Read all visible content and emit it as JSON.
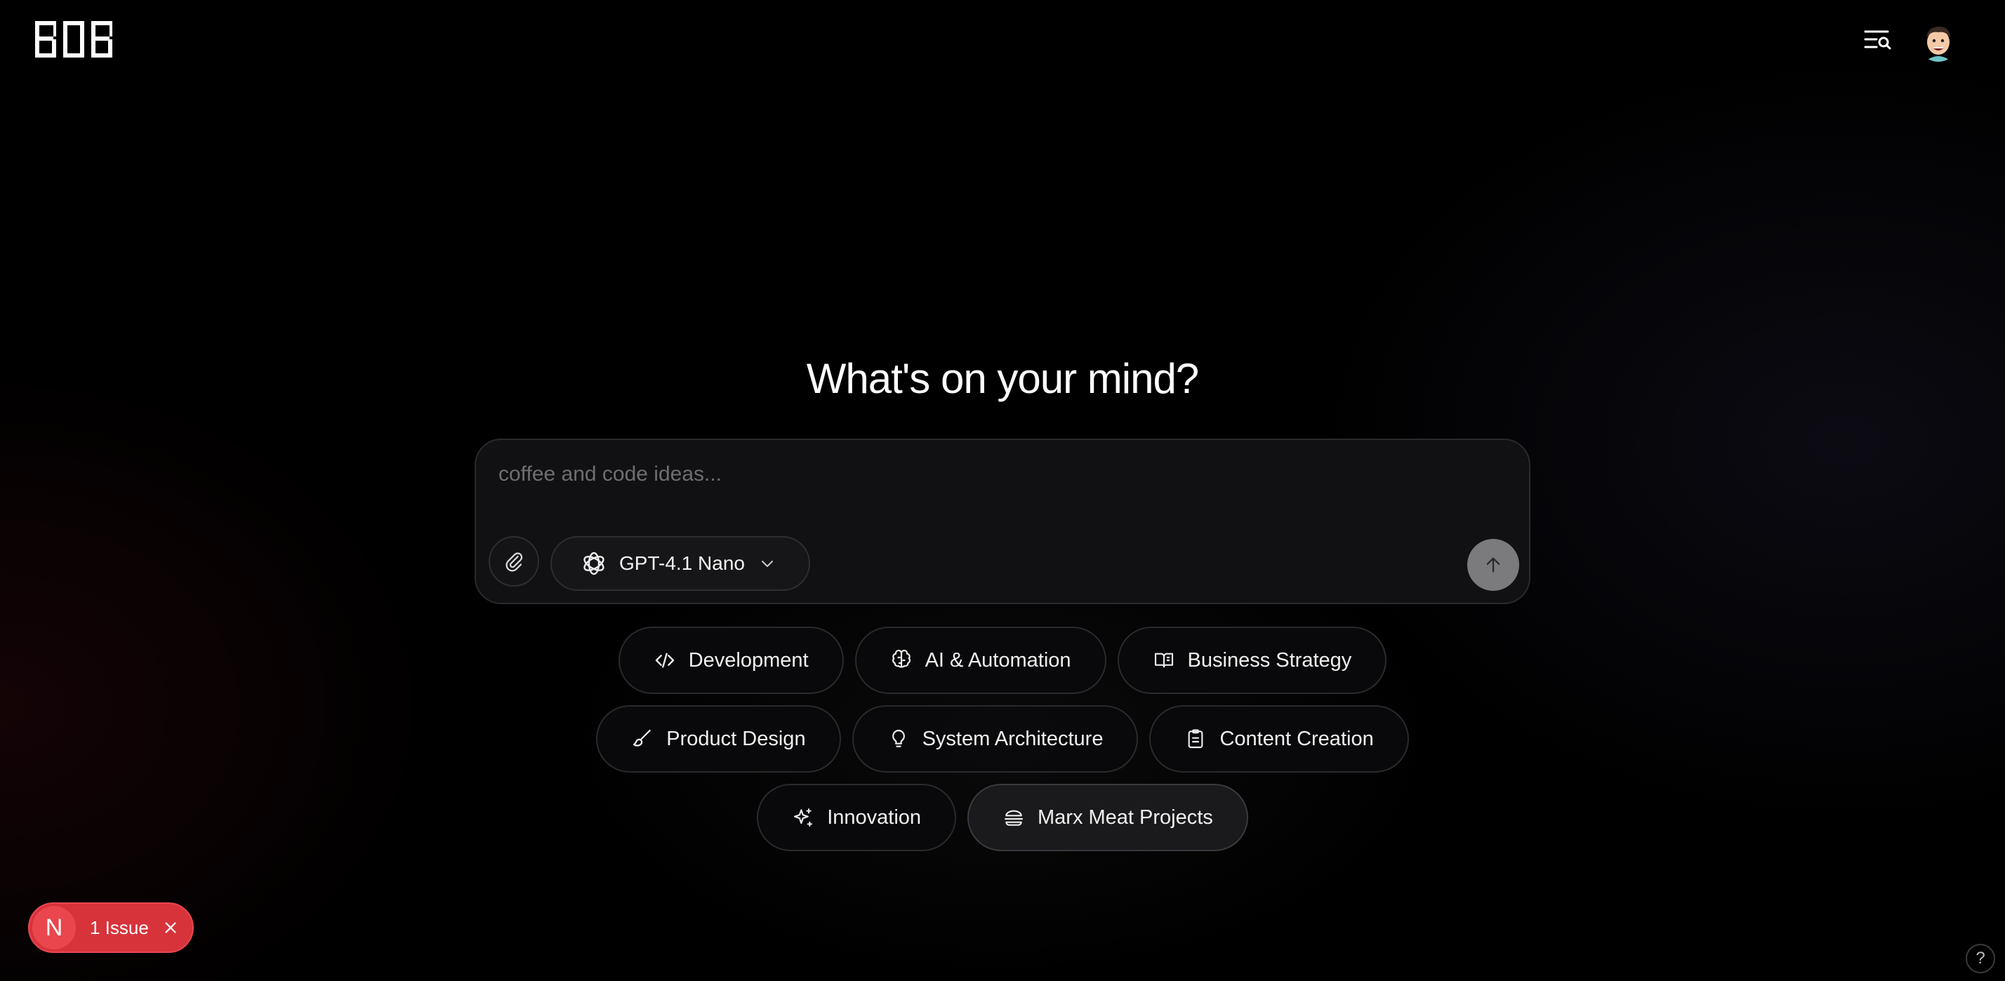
{
  "header": {
    "logo_text": "BOB",
    "menu_icon": "menu-search-icon",
    "avatar_icon": "user-avatar"
  },
  "main": {
    "title": "What's on your mind?",
    "composer": {
      "placeholder": "coffee and code ideas...",
      "value": "",
      "model_label": "GPT-4.1 Nano"
    },
    "chips": [
      {
        "label": "Development",
        "icon": "code-icon"
      },
      {
        "label": "AI & Automation",
        "icon": "brain-icon"
      },
      {
        "label": "Business Strategy",
        "icon": "book-open-icon"
      },
      {
        "label": "Product Design",
        "icon": "brush-icon"
      },
      {
        "label": "System Architecture",
        "icon": "lightbulb-icon"
      },
      {
        "label": "Content Creation",
        "icon": "clipboard-icon"
      },
      {
        "label": "Innovation",
        "icon": "sparkles-icon"
      },
      {
        "label": "Marx Meat Projects",
        "icon": "burger-icon"
      }
    ]
  },
  "dev_overlay": {
    "badge_letter": "N",
    "issues_label": "1 Issue",
    "help_label": "?"
  },
  "colors": {
    "background": "#000000",
    "issue_badge": "#d7333b",
    "send_button": "#7b7b7e"
  }
}
